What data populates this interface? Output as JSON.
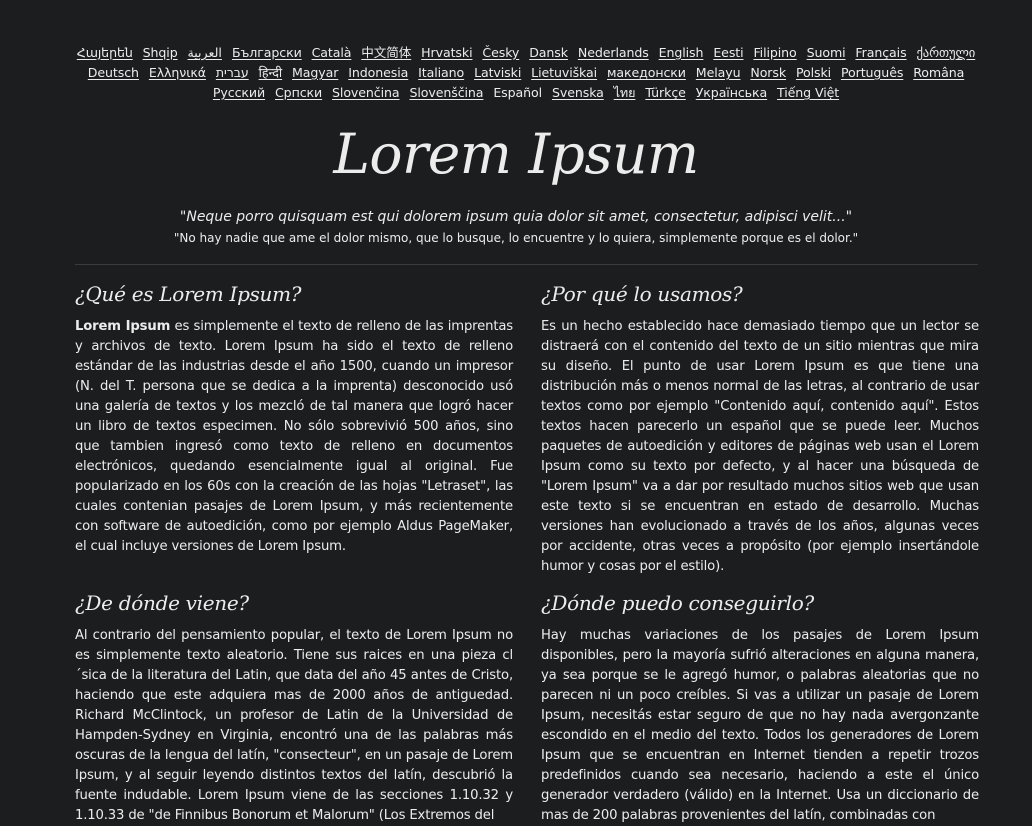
{
  "languages": [
    {
      "label": "Հայերեն",
      "current": false
    },
    {
      "label": "Shqip",
      "current": false
    },
    {
      "label": "العربية",
      "current": false
    },
    {
      "label": "Български",
      "current": false
    },
    {
      "label": "Català",
      "current": false
    },
    {
      "label": "中文简体",
      "current": false
    },
    {
      "label": "Hrvatski",
      "current": false
    },
    {
      "label": "Česky",
      "current": false
    },
    {
      "label": "Dansk",
      "current": false
    },
    {
      "label": "Nederlands",
      "current": false
    },
    {
      "label": "English",
      "current": false
    },
    {
      "label": "Eesti",
      "current": false
    },
    {
      "label": "Filipino",
      "current": false
    },
    {
      "label": "Suomi",
      "current": false
    },
    {
      "label": "Français",
      "current": false
    },
    {
      "label": "ქართული",
      "current": false
    },
    {
      "label": "Deutsch",
      "current": false
    },
    {
      "label": "Ελληνικά",
      "current": false
    },
    {
      "label": "עברית",
      "current": false
    },
    {
      "label": "हिन्दी",
      "current": false
    },
    {
      "label": "Magyar",
      "current": false
    },
    {
      "label": "Indonesia",
      "current": false
    },
    {
      "label": "Italiano",
      "current": false
    },
    {
      "label": "Latviski",
      "current": false
    },
    {
      "label": "Lietuviškai",
      "current": false
    },
    {
      "label": "македонски",
      "current": false
    },
    {
      "label": "Melayu",
      "current": false
    },
    {
      "label": "Norsk",
      "current": false
    },
    {
      "label": "Polski",
      "current": false
    },
    {
      "label": "Português",
      "current": false
    },
    {
      "label": "Româna",
      "current": false
    },
    {
      "label": "Pyccкий",
      "current": false
    },
    {
      "label": "Српски",
      "current": false
    },
    {
      "label": "Slovenčina",
      "current": false
    },
    {
      "label": "Slovenščina",
      "current": false
    },
    {
      "label": "Español",
      "current": true
    },
    {
      "label": "Svenska",
      "current": false
    },
    {
      "label": "ไทย",
      "current": false
    },
    {
      "label": "Türkçe",
      "current": false
    },
    {
      "label": "Українська",
      "current": false
    },
    {
      "label": "Tiếng Việt",
      "current": false
    }
  ],
  "header": {
    "title": "Lorem Ipsum",
    "quote_latin": "\"Neque porro quisquam est qui dolorem ipsum quia dolor sit amet, consectetur, adipisci velit...\"",
    "quote_translation": "\"No hay nadie que ame el dolor mismo, que lo busque, lo encuentre y lo quiera, simplemente porque es el dolor.\""
  },
  "sections": {
    "what": {
      "heading": "¿Qué es Lorem Ipsum?",
      "lead": "Lorem Ipsum",
      "body": " es simplemente el texto de relleno de las imprentas y archivos de texto. Lorem Ipsum ha sido el texto de relleno estándar de las industrias desde el año 1500, cuando un impresor (N. del T. persona que se dedica a la imprenta) desconocido usó una galería de textos y los mezcló de tal manera que logró hacer un libro de textos especimen. No sólo sobrevivió 500 años, sino que tambien ingresó como texto de relleno en documentos electrónicos, quedando esencialmente igual al original. Fue popularizado en los 60s con la creación de las hojas \"Letraset\", las cuales contenian pasajes de Lorem Ipsum, y más recientemente con software de autoedición, como por ejemplo Aldus PageMaker, el cual incluye versiones de Lorem Ipsum."
    },
    "why": {
      "heading": "¿Por qué lo usamos?",
      "body": "Es un hecho establecido hace demasiado tiempo que un lector se distraerá con el contenido del texto de un sitio mientras que mira su diseño. El punto de usar Lorem Ipsum es que tiene una distribución más o menos normal de las letras, al contrario de usar textos como por ejemplo \"Contenido aquí, contenido aquí\". Estos textos hacen parecerlo un español que se puede leer. Muchos paquetes de autoedición y editores de páginas web usan el Lorem Ipsum como su texto por defecto, y al hacer una búsqueda de \"Lorem Ipsum\" va a dar por resultado muchos sitios web que usan este texto si se encuentran en estado de desarrollo. Muchas versiones han evolucionado a través de los años, algunas veces por accidente, otras veces a propósito (por ejemplo insertándole humor y cosas por el estilo)."
    },
    "where_from": {
      "heading": "¿De dónde viene?",
      "body": "Al contrario del pensamiento popular, el texto de Lorem Ipsum no es simplemente texto aleatorio. Tiene sus raices en una pieza cl´sica de la literatura del Latin, que data del año 45 antes de Cristo, haciendo que este adquiera mas de 2000 años de antiguedad. Richard McClintock, un profesor de Latin de la Universidad de Hampden-Sydney en Virginia, encontró una de las palabras más oscuras de la lengua del latín, \"consecteur\", en un pasaje de Lorem Ipsum, y al seguir leyendo distintos textos del latín, descubrió la fuente indudable. Lorem Ipsum viene de las secciones 1.10.32 y 1.10.33 de \"de Finnibus Bonorum et Malorum\" (Los Extremos del"
    },
    "where_get": {
      "heading": "¿Dónde puedo conseguirlo?",
      "body": "Hay muchas variaciones de los pasajes de Lorem Ipsum disponibles, pero la mayoría sufrió alteraciones en alguna manera, ya sea porque se le agregó humor, o palabras aleatorias que no parecen ni un poco creíbles. Si vas a utilizar un pasaje de Lorem Ipsum, necesitás estar seguro de que no hay nada avergonzante escondido en el medio del texto. Todos los generadores de Lorem Ipsum que se encuentran en Internet tienden a repetir trozos predefinidos cuando sea necesario, haciendo a este el único generador verdadero (válido) en la Internet. Usa un diccionario de mas de 200 palabras provenientes del latín, combinadas con"
    }
  }
}
